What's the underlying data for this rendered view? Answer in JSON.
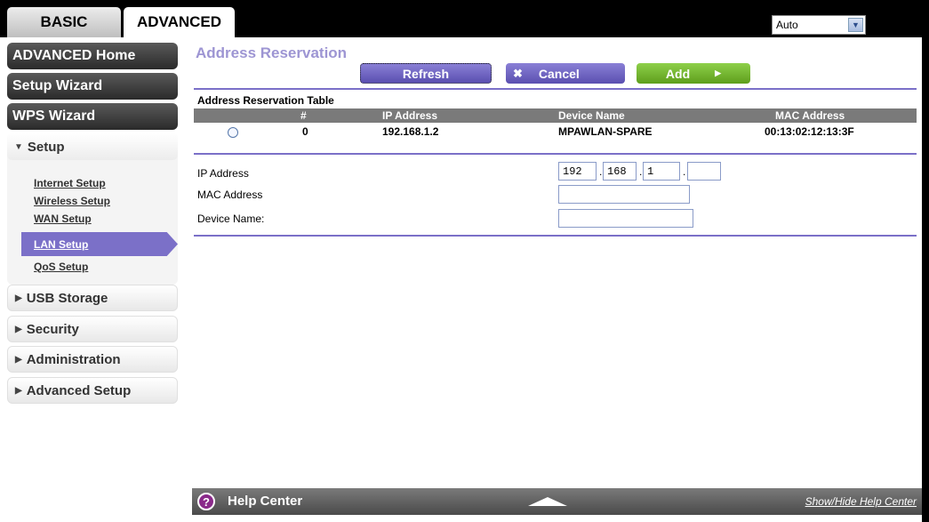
{
  "tabs": {
    "basic": "BASIC",
    "advanced": "ADVANCED"
  },
  "language": {
    "selected": "Auto"
  },
  "sidebar": {
    "advanced_home": "ADVANCED Home",
    "setup_wizard": "Setup Wizard",
    "wps_wizard": "WPS Wizard",
    "setup": "Setup",
    "setup_items": [
      "Internet Setup",
      "Wireless Setup",
      "WAN Setup",
      "LAN Setup",
      "QoS Setup"
    ],
    "usb_storage": "USB Storage",
    "security": "Security",
    "administration": "Administration",
    "advanced_setup": "Advanced Setup"
  },
  "main": {
    "title": "Address Reservation",
    "buttons": {
      "refresh": "Refresh",
      "cancel": "Cancel",
      "add": "Add"
    },
    "table": {
      "title": "Address Reservation Table",
      "headers": [
        "#",
        "IP Address",
        "Device Name",
        "MAC Address"
      ],
      "rows": [
        {
          "index": "0",
          "ip": "192.168.1.2",
          "device": "MPAWLAN-SPARE",
          "mac": "00:13:02:12:13:3F"
        }
      ]
    },
    "form": {
      "ip_label": "IP Address",
      "ip_octets": [
        "192",
        "168",
        "1",
        ""
      ],
      "mac_label": "MAC Address",
      "device_label": "Device Name:"
    }
  },
  "help": {
    "label": "Help Center",
    "toggle": "Show/Hide Help Center"
  },
  "colors": {
    "accent": "#7b70c8",
    "add_green": "#6fb52e",
    "title": "#9d95d3"
  }
}
